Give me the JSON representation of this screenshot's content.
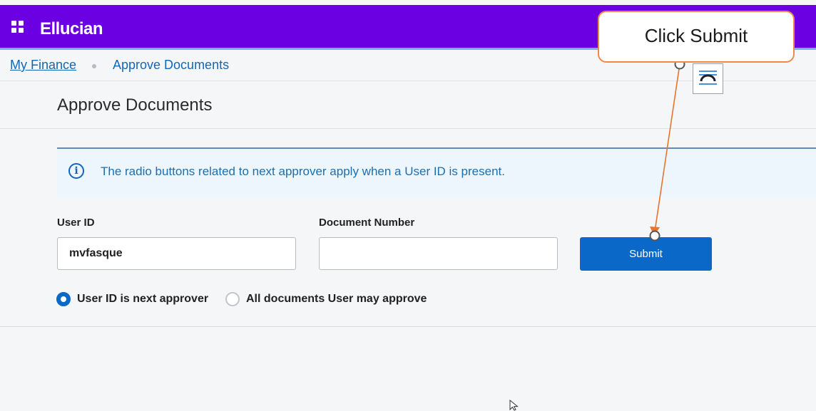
{
  "header": {
    "logo_text": "Ellucian",
    "brand_color": "#6b00e3",
    "apps_icon": "grid-icon"
  },
  "breadcrumb": {
    "parent": "My Finance",
    "current": "Approve Documents"
  },
  "page": {
    "title": "Approve Documents"
  },
  "info_banner": {
    "icon": "info-icon",
    "text": "The radio buttons related to next approver apply when a User ID is present."
  },
  "form": {
    "user_id": {
      "label": "User ID",
      "value": "mvfasque"
    },
    "document_number": {
      "label": "Document Number",
      "value": ""
    },
    "submit_label": "Submit",
    "radio_options": [
      {
        "label": "User ID is next approver",
        "checked": true
      },
      {
        "label": "All documents User may approve",
        "checked": false
      }
    ]
  },
  "callout": {
    "text": "Click Submit",
    "border_color": "#f0884a"
  },
  "accent_color": "#0a68c9"
}
